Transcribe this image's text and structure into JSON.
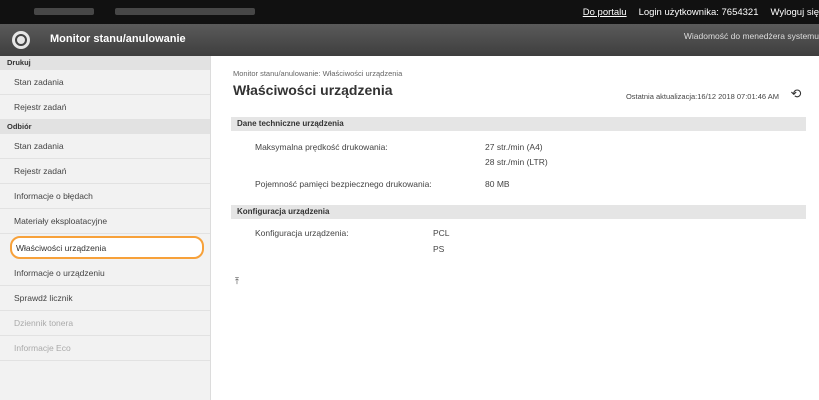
{
  "topbar": {
    "portal_link": "Do portalu",
    "login_label": "Login użytkownika:",
    "login_user": "7654321",
    "logout_link": "Wyloguj się"
  },
  "header": {
    "title": "Monitor stanu/anulowanie",
    "message_link": "Wiadomość do menedżera systemu"
  },
  "sidebar": {
    "sections": [
      {
        "title": "Drukuj",
        "items": [
          "Stan zadania",
          "Rejestr zadań"
        ]
      },
      {
        "title": "Odbiór",
        "items": [
          "Stan zadania",
          "Rejestr zadań"
        ]
      }
    ],
    "items": [
      "Informacje o błędach",
      "Materiały eksploatacyjne",
      "Właściwości urządzenia",
      "Informacje o urządzeniu",
      "Sprawdź licznik",
      "Dziennik tonera",
      "Informacje Eco"
    ],
    "selected_item": "Właściwości urządzenia"
  },
  "main": {
    "breadcrumb": "Monitor stanu/anulowanie: Właściwości urządzenia",
    "title": "Właściwości urządzenia",
    "last_updated": "Ostatnia aktualizacja:16/12 2018 07:01:46 AM",
    "specs": {
      "heading": "Dane techniczne urządzenia",
      "max_speed_label": "Maksymalna prędkość drukowania:",
      "max_speed_a4": "27 str./min (A4)",
      "max_speed_ltr": "28 str./min (LTR)",
      "secure_mem_label": "Pojemność pamięci bezpiecznego drukowania:",
      "secure_mem_value": "80 MB"
    },
    "config": {
      "heading": "Konfiguracja urządzenia",
      "label": "Konfiguracja urządzenia:",
      "values": [
        "PCL",
        "PS"
      ]
    },
    "to_top": "⤒"
  },
  "icons": {
    "refresh": "refresh-icon",
    "logo": "device-logo-icon"
  },
  "colors": {
    "selected_border": "#f7a13a",
    "topbar_bg": "#111111",
    "header_bg": "#4a4a4a"
  }
}
